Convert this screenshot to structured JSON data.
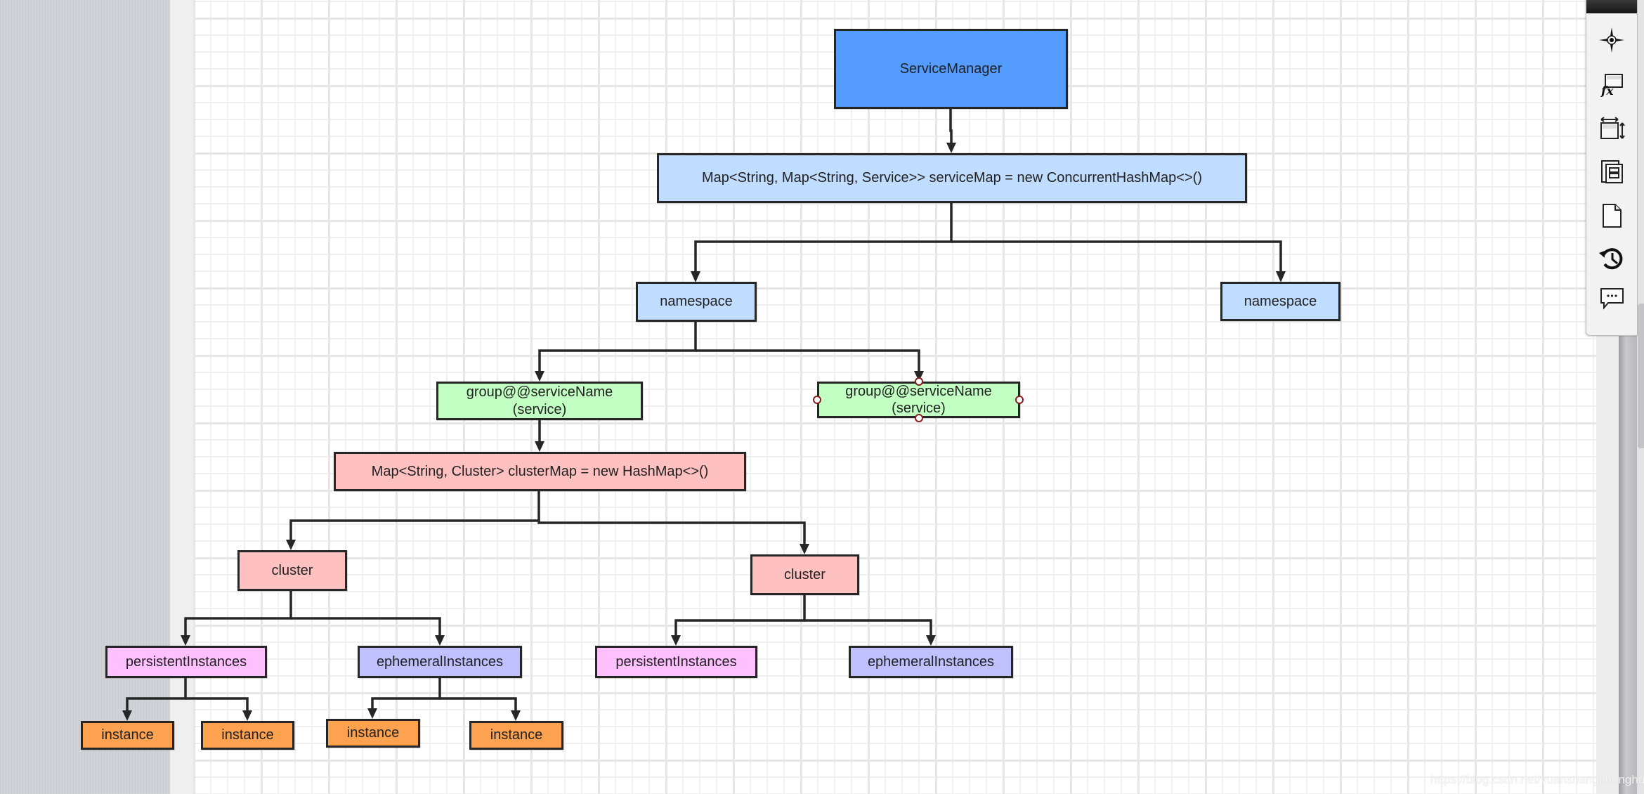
{
  "colors": {
    "service_manager": "#559cff",
    "service_map": "#c0dcff",
    "namespace": "#c0dcff",
    "service": "#c2ffc2",
    "cluster_map": "#ffc0c0",
    "cluster": "#ffc0c0",
    "persistent": "#ffc0ff",
    "ephemeral": "#c0c0ff",
    "instance": "#ffa24f",
    "border": "#262626",
    "handle_border": "#8a1e1e"
  },
  "nodes": {
    "service_manager": "ServiceManager",
    "service_map": "Map<String, Map<String, Service>> serviceMap = new ConcurrentHashMap<>()",
    "namespace_1": "namespace",
    "namespace_2": "namespace",
    "service_1_line1": "group@@serviceName",
    "service_1_line2": "(service)",
    "service_2_line1": "group@@serviceName",
    "service_2_line2": "(service)",
    "cluster_map": "Map<String, Cluster> clusterMap = new HashMap<>()",
    "cluster_1": "cluster",
    "cluster_2": "cluster",
    "persistent_1": "persistentInstances",
    "ephemeral_1": "ephemeralInstances",
    "persistent_2": "persistentInstances",
    "ephemeral_2": "ephemeralInstances",
    "instance_1": "instance",
    "instance_2": "instance",
    "instance_3": "instance",
    "instance_4": "instance"
  },
  "toolbar": {
    "items": [
      {
        "icon": "compass-icon",
        "label": "Navigator"
      },
      {
        "icon": "formula-icon",
        "label": "Formula"
      },
      {
        "icon": "resize-icon",
        "label": "Size"
      },
      {
        "icon": "pages-icon",
        "label": "Pages"
      },
      {
        "icon": "document-icon",
        "label": "Document"
      },
      {
        "icon": "history-icon",
        "label": "History"
      },
      {
        "icon": "comment-icon",
        "label": "Comments"
      }
    ]
  },
  "selected_node": "service_2",
  "watermark": "https://blog.csdn.net/yuanshangshenghuo"
}
